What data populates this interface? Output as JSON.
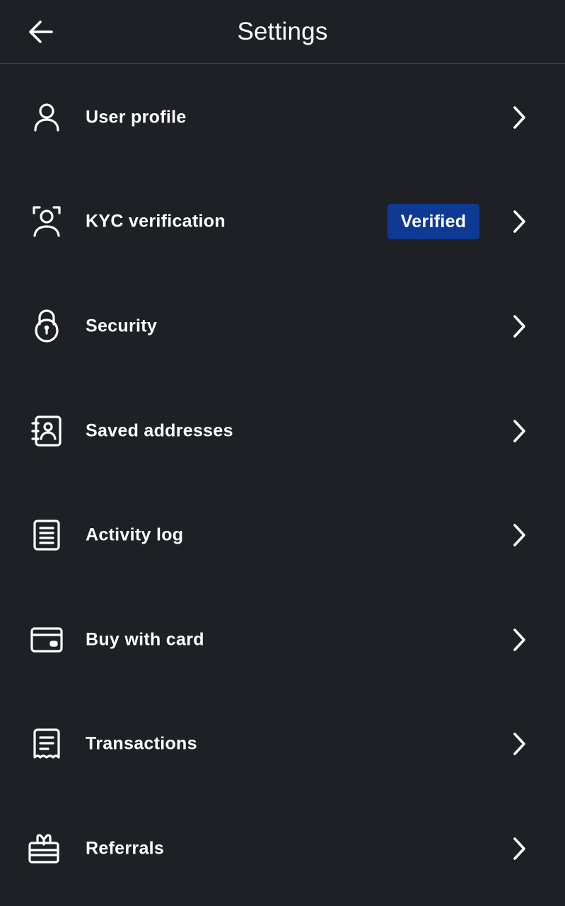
{
  "header": {
    "title": "Settings",
    "back_icon": "arrow-left-icon"
  },
  "menu": {
    "items": [
      {
        "label": "User profile",
        "icon": "user-icon"
      },
      {
        "label": "KYC verification",
        "icon": "face-scan-icon",
        "badge": "Verified"
      },
      {
        "label": "Security",
        "icon": "lock-icon"
      },
      {
        "label": "Saved addresses",
        "icon": "address-book-icon"
      },
      {
        "label": "Activity log",
        "icon": "document-icon"
      },
      {
        "label": "Buy with card",
        "icon": "credit-card-icon"
      },
      {
        "label": "Transactions",
        "icon": "receipt-icon"
      },
      {
        "label": "Referrals",
        "icon": "gift-icon"
      }
    ],
    "chevron_icon": "chevron-right-icon"
  },
  "colors": {
    "background": "#1f2025",
    "text": "#ffffff",
    "divider": "#46474d",
    "badge_bg": "#0f3a94"
  }
}
